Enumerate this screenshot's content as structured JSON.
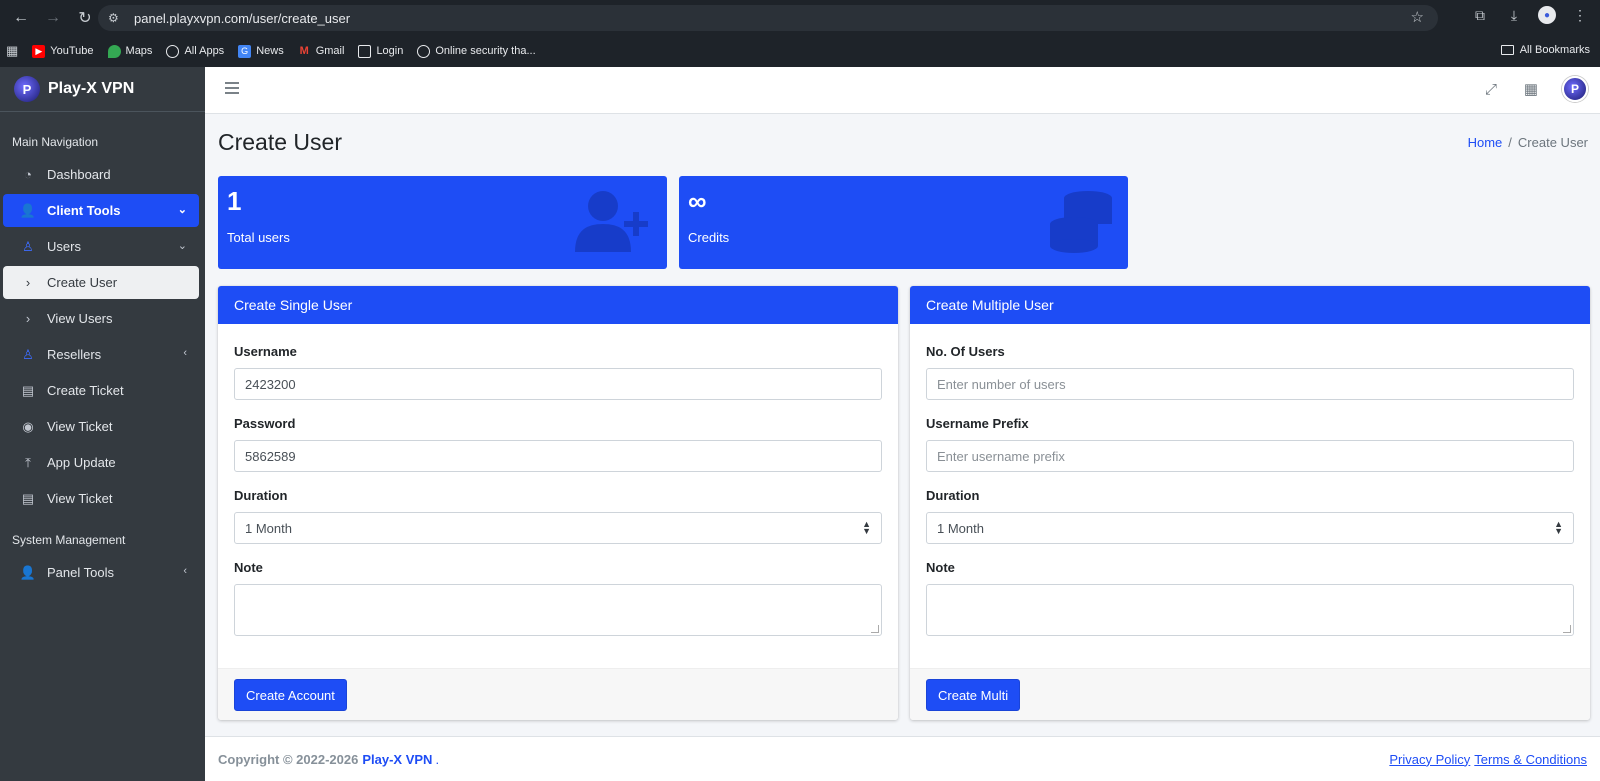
{
  "browser": {
    "url": "panel.playxvpn.com/user/create_user",
    "bookmarks": [
      "YouTube",
      "Maps",
      "All Apps",
      "News",
      "Gmail",
      "Login",
      "Online security tha..."
    ],
    "all_bookmarks": "All Bookmarks"
  },
  "sidebar": {
    "brand": "Play-X VPN",
    "main_nav_header": "Main Navigation",
    "items": [
      {
        "label": "Dashboard"
      },
      {
        "label": "Client Tools"
      },
      {
        "label": "Users"
      },
      {
        "label": "Create User"
      },
      {
        "label": "View Users"
      },
      {
        "label": "Resellers"
      },
      {
        "label": "Create Ticket"
      },
      {
        "label": "View Ticket"
      },
      {
        "label": "App Update"
      },
      {
        "label": "View Ticket"
      }
    ],
    "system_header": "System Management",
    "panel_tools": "Panel Tools"
  },
  "header": {
    "title": "Create User",
    "breadcrumb_home": "Home",
    "breadcrumb_sep": "/",
    "breadcrumb_current": "Create User"
  },
  "stats": {
    "total_users_value": "1",
    "total_users_label": "Total users",
    "credits_value": "∞",
    "credits_label": "Credits"
  },
  "single": {
    "title": "Create Single User",
    "username_label": "Username",
    "username_value": "2423200",
    "password_label": "Password",
    "password_value": "5862589",
    "duration_label": "Duration",
    "duration_value": "1 Month",
    "note_label": "Note",
    "button": "Create Account"
  },
  "multi": {
    "title": "Create Multiple User",
    "count_label": "No. Of Users",
    "count_placeholder": "Enter number of users",
    "prefix_label": "Username Prefix",
    "prefix_placeholder": "Enter username prefix",
    "duration_label": "Duration",
    "duration_value": "1 Month",
    "note_label": "Note",
    "button": "Create Multi"
  },
  "footer": {
    "copyright": "Copyright © 2022-2026",
    "brand": "Play-X VPN",
    "dot": ".",
    "privacy": "Privacy Policy",
    "terms": "Terms & Conditions"
  },
  "colors": {
    "primary": "#1e4df5",
    "sidebar_bg": "#343a40",
    "browser_bg": "#1e2329"
  }
}
